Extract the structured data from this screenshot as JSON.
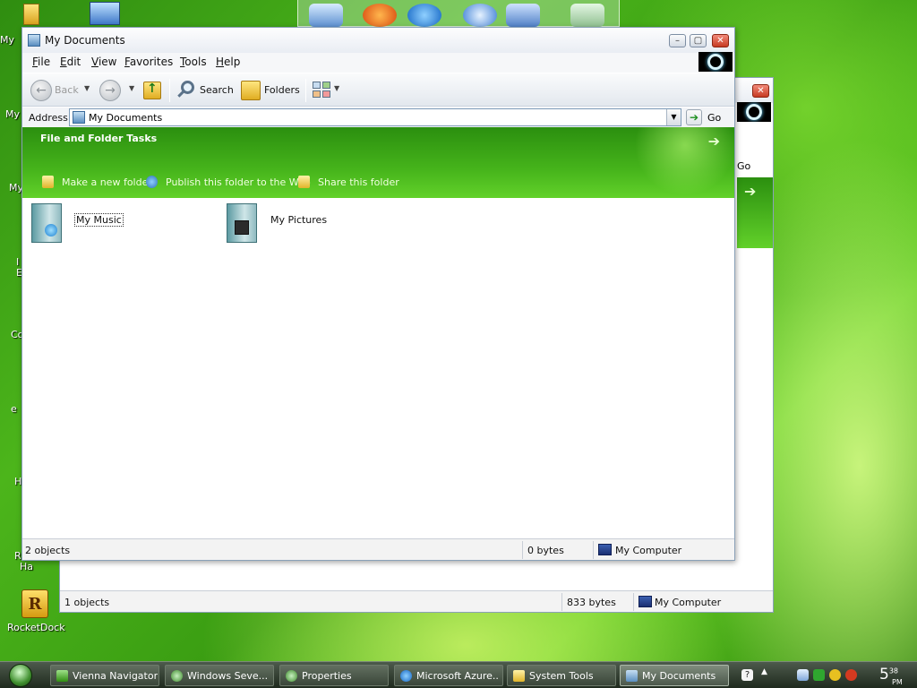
{
  "desktop": {
    "stub_labels": [
      "My",
      "My",
      "My",
      "I",
      "E",
      "Co",
      "e",
      "H",
      "R",
      "Ha"
    ],
    "rocketdock_label": "RocketDock",
    "rocketdock_glyph": "R"
  },
  "back_window": {
    "go_label": "Go",
    "status": {
      "objects": "1 objects",
      "size": "833 bytes",
      "location": "My Computer"
    }
  },
  "front_window": {
    "title": "My Documents",
    "menu": [
      "File",
      "Edit",
      "View",
      "Favorites",
      "Tools",
      "Help"
    ],
    "toolbar": {
      "back_label": "Back",
      "search_label": "Search",
      "folders_label": "Folders"
    },
    "address": {
      "label": "Address",
      "value": "My Documents",
      "go_label": "Go"
    },
    "tasks": {
      "title": "File and Folder Tasks",
      "links": [
        "Make a new folder",
        "Publish this folder to the Web",
        "Share this folder"
      ]
    },
    "items": [
      {
        "label": "My Music",
        "selected": true
      },
      {
        "label": "My Pictures",
        "selected": false
      }
    ],
    "status": {
      "objects": "2 objects",
      "size": "0 bytes",
      "location": "My Computer"
    }
  },
  "taskbar": {
    "buttons": [
      {
        "label": "Vienna Navigator",
        "active": false
      },
      {
        "label": "Windows Seve...",
        "active": false
      },
      {
        "label": "Properties",
        "active": false
      },
      {
        "label": "Microsoft Azure...",
        "active": false
      },
      {
        "label": "System Tools",
        "active": false
      },
      {
        "label": "My Documents",
        "active": true
      }
    ],
    "clock": {
      "hour": "5",
      "minutes": "38",
      "ampm": "PM"
    }
  },
  "colors": {
    "task_banner": "#46b41b",
    "title_bar": "#e9edf3",
    "close_button": "#c63b22",
    "taskbar": "#2e3a2d"
  },
  "icons": [
    "my-documents-icon",
    "back-icon",
    "forward-icon",
    "up-folder-icon",
    "search-icon",
    "folders-icon",
    "views-icon",
    "go-arrow-icon",
    "new-folder-icon",
    "publish-web-icon",
    "share-folder-icon",
    "my-music-folder-icon",
    "my-pictures-folder-icon",
    "my-computer-icon",
    "start-orb-icon",
    "clock"
  ]
}
